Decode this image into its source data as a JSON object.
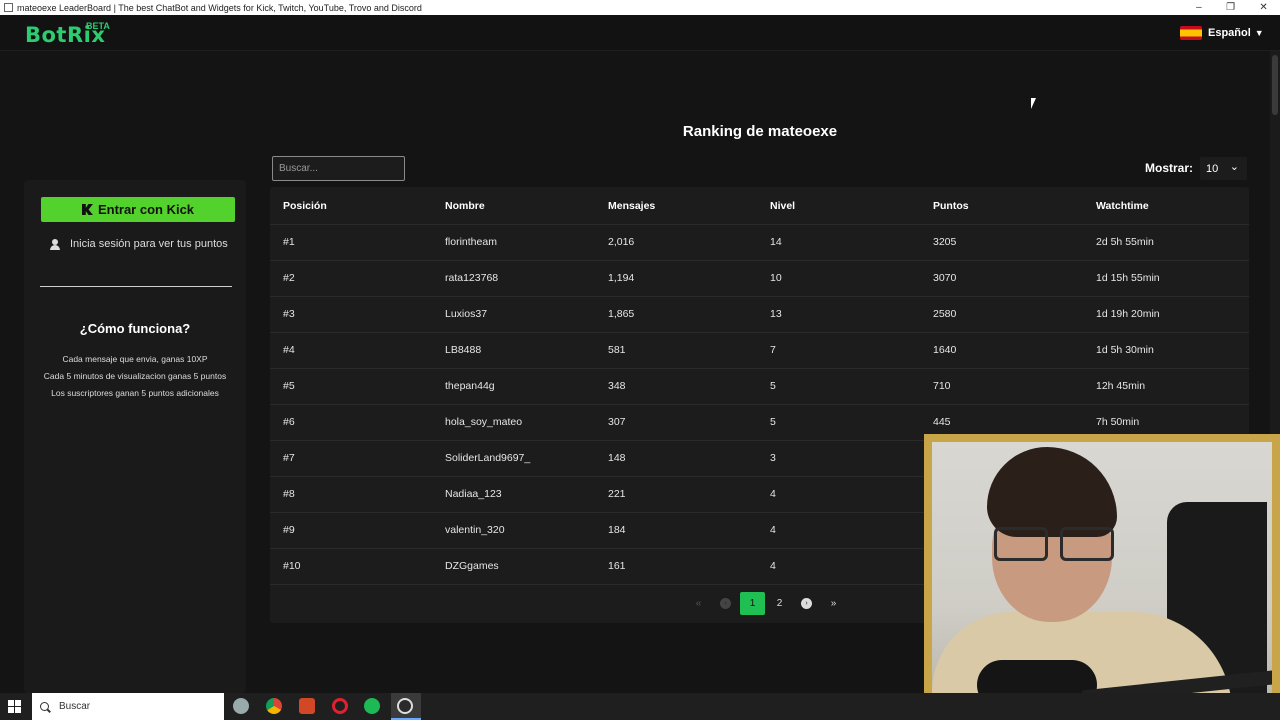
{
  "window": {
    "title": "mateoexe LeaderBoard | The best ChatBot and Widgets for Kick, Twitch, YouTube, Trovo and Discord"
  },
  "nav": {
    "logo": "BotRix",
    "logo_badge": "BETA",
    "language": "Español",
    "accent": "#2ecc71"
  },
  "sidebar": {
    "kick_button": "Entrar con Kick",
    "login_hint": "Inicia sesión para ver tus puntos",
    "how_title": "¿Cómo funciona?",
    "how_lines": [
      "Cada mensaje que envia, ganas 10XP",
      "Cada 5 minutos de visualizacion ganas 5 puntos",
      "Los suscriptores ganan 5 puntos adicionales"
    ]
  },
  "main": {
    "title": "Ranking de mateoexe",
    "search_placeholder": "Buscar...",
    "show_label": "Mostrar:",
    "show_value": "10",
    "columns": [
      "Posición",
      "Nombre",
      "Mensajes",
      "Nivel",
      "Puntos",
      "Watchtime"
    ],
    "rows": [
      [
        "#1",
        "florintheam",
        "2,016",
        "14",
        "3205",
        "2d 5h 55min"
      ],
      [
        "#2",
        "rata123768",
        "1,194",
        "10",
        "3070",
        "1d 15h 55min"
      ],
      [
        "#3",
        "Luxios37",
        "1,865",
        "13",
        "2580",
        "1d 19h 20min"
      ],
      [
        "#4",
        "LB8488",
        "581",
        "7",
        "1640",
        "1d 5h 30min"
      ],
      [
        "#5",
        "thepan44g",
        "348",
        "5",
        "710",
        "12h 45min"
      ],
      [
        "#6",
        "hola_soy_mateo",
        "307",
        "5",
        "445",
        "7h 50min"
      ],
      [
        "#7",
        "SoliderLand9697_",
        "148",
        "3",
        "",
        ""
      ],
      [
        "#8",
        "Nadiaa_123",
        "221",
        "4",
        "",
        ""
      ],
      [
        "#9",
        "valentin_320",
        "184",
        "4",
        "",
        ""
      ],
      [
        "#10",
        "DZGgames",
        "161",
        "4",
        "",
        ""
      ]
    ],
    "pagination": {
      "first": "«",
      "prev": "‹",
      "pages": [
        "1",
        "2"
      ],
      "current": "1",
      "next": "›",
      "last": "»"
    }
  },
  "taskbar": {
    "search_text": "Buscar",
    "apps": [
      "settings-icon",
      "chrome-icon",
      "powerpoint-icon",
      "opera-icon",
      "spotify-icon",
      "obs-icon"
    ]
  }
}
